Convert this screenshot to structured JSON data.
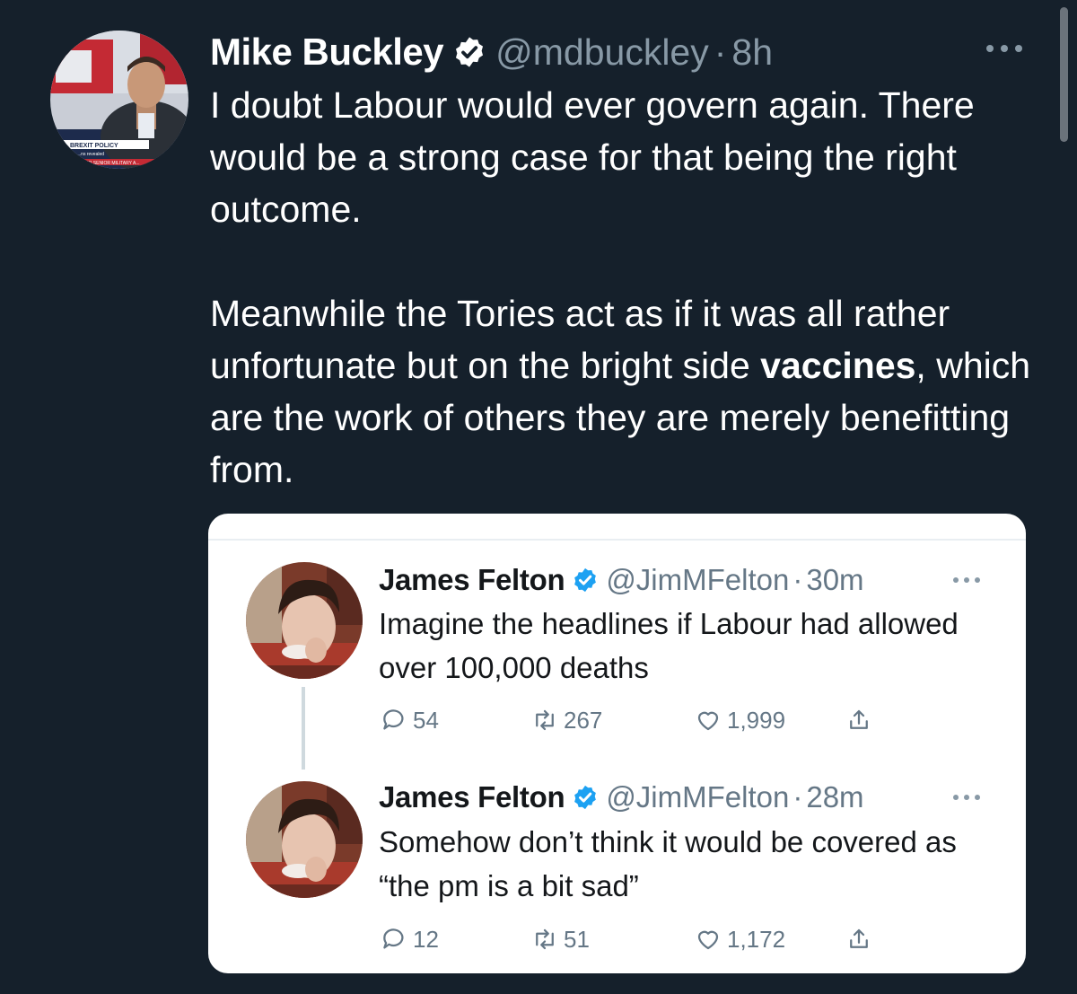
{
  "main_tweet": {
    "author_name": "Mike Buckley",
    "handle": "@mdbuckley",
    "separator": "·",
    "time": "8h",
    "avatar_caption": {
      "line1": "BREXIT POLICY",
      "line2": "...ns revealed",
      "line3": "...E CO SENIOR MILITARY A..."
    },
    "text": {
      "paragraph1": "I doubt Labour would ever govern again. There would be a strong case for that being the right outcome.",
      "paragraph2_prefix": "Meanwhile the Tories act as if it was all rather unfortunate but on the bright side ",
      "paragraph2_bold": "vaccines",
      "paragraph2_suffix": ", which are the work of others they are merely benefitting from."
    }
  },
  "quoted_thread": {
    "tweets": [
      {
        "author_name": "James Felton",
        "handle": "@JimMFelton",
        "separator": "·",
        "time": "30m",
        "text": "Imagine the headlines if Labour had allowed over 100,000 deaths",
        "replies": "54",
        "retweets": "267",
        "likes": "1,999"
      },
      {
        "author_name": "James Felton",
        "handle": "@JimMFelton",
        "separator": "·",
        "time": "28m",
        "text": "Somehow don’t think it would be covered as “the pm is a bit sad”",
        "replies": "12",
        "retweets": "51",
        "likes": "1,172"
      }
    ]
  },
  "colors": {
    "background": "#15202b",
    "primary_text": "#ffffff",
    "secondary_text": "#8899a6",
    "card_background": "#ffffff",
    "card_text": "#14171a",
    "card_secondary_text": "#657786",
    "verified_blue": "#1da1f2"
  },
  "icons": {
    "verified": "verified-badge-icon",
    "more": "more-dots-icon",
    "reply": "reply-icon",
    "retweet": "retweet-icon",
    "like": "heart-icon",
    "share": "share-icon"
  }
}
